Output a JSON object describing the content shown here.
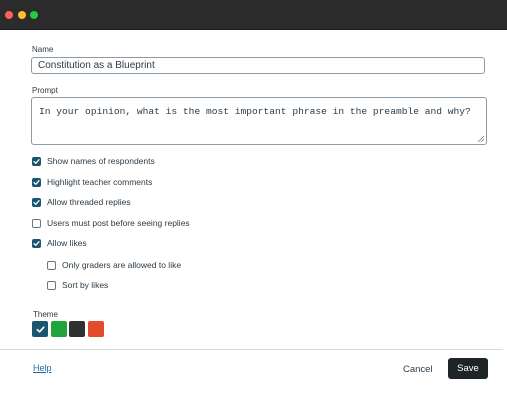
{
  "form": {
    "name_label": "Name",
    "name_value": "Constitution as a Blueprint",
    "prompt_label": "Prompt",
    "prompt_value": "In your opinion, what is the most important phrase in the preamble and why?"
  },
  "options": [
    {
      "label": "Show names of respondents",
      "checked": true
    },
    {
      "label": "Highlight teacher comments",
      "checked": true
    },
    {
      "label": "Allow threaded replies",
      "checked": true
    },
    {
      "label": "Users must post before seeing replies",
      "checked": false
    },
    {
      "label": "Allow likes",
      "checked": true
    }
  ],
  "sub_options": [
    {
      "label": "Only graders are allowed to like",
      "checked": false
    },
    {
      "label": "Sort by likes",
      "checked": false
    }
  ],
  "theme": {
    "label": "Theme",
    "swatches": [
      {
        "name": "blue",
        "color": "#1a5670",
        "selected": true
      },
      {
        "name": "green",
        "color": "#1fa53b",
        "selected": false
      },
      {
        "name": "dark",
        "color": "#2f3133",
        "selected": false
      },
      {
        "name": "red",
        "color": "#e34b2d",
        "selected": false
      }
    ]
  },
  "footer": {
    "help_label": "Help",
    "cancel_label": "Cancel",
    "save_label": "Save"
  }
}
